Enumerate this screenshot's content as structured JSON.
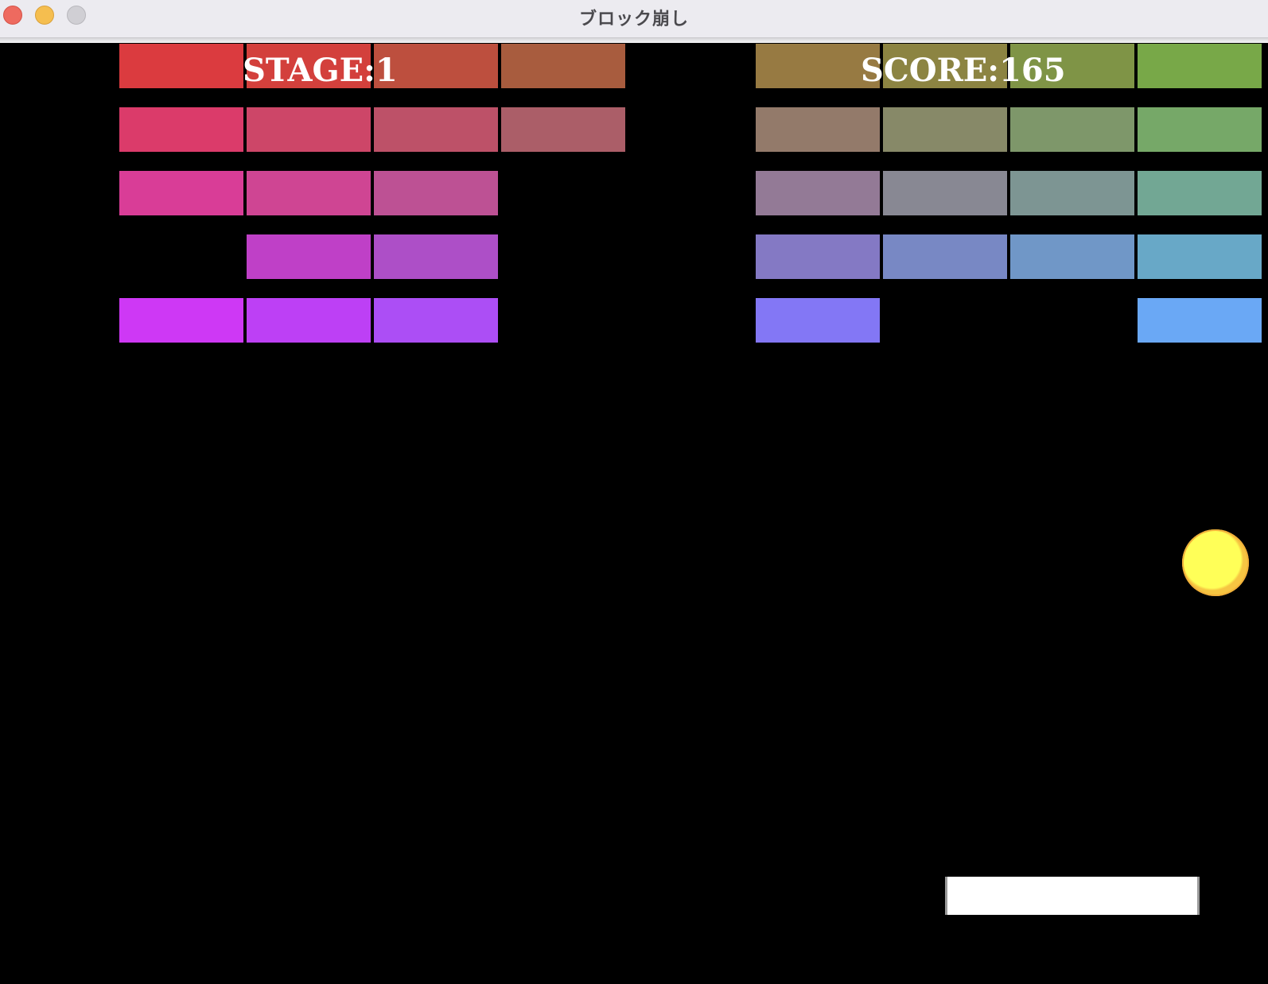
{
  "window": {
    "title": "ブロック崩し"
  },
  "hud": {
    "stage_text": "STAGE:1",
    "score_text": "SCORE:165"
  },
  "game": {
    "background_color": "#000000",
    "ball_color": "#ffff58",
    "paddle_color": "#ffffff",
    "block_grid": {
      "columns_per_group": 4,
      "rows": [
        {
          "left": [
            "#db3b3f",
            "#d3403c",
            "#bd4f3e",
            "#a85c3e"
          ],
          "right": [
            "#977a42",
            "#8c8442",
            "#7f9446",
            "#78a848"
          ]
        },
        {
          "left": [
            "#db3b6a",
            "#cd4668",
            "#bd5168",
            "#ab5e68"
          ],
          "right": [
            "#937a6a",
            "#878968",
            "#7e976a",
            "#76a868"
          ]
        },
        {
          "left": [
            "#d93d97",
            "#cf4593",
            "#bd5194",
            null
          ],
          "right": [
            "#937a96",
            "#888893",
            "#7d9593",
            "#72a794"
          ]
        },
        {
          "left": [
            null,
            "#bf40c7",
            "#ad4fc7",
            null
          ],
          "right": [
            "#8479c4",
            "#7888c4",
            "#7097c7",
            "#68a8c7"
          ]
        },
        {
          "left": [
            "#ce38f5",
            "#bd40f5",
            "#ac4ef5",
            null
          ],
          "right": [
            "#8377f5",
            null,
            null,
            "#6aa8f5"
          ]
        }
      ]
    }
  }
}
